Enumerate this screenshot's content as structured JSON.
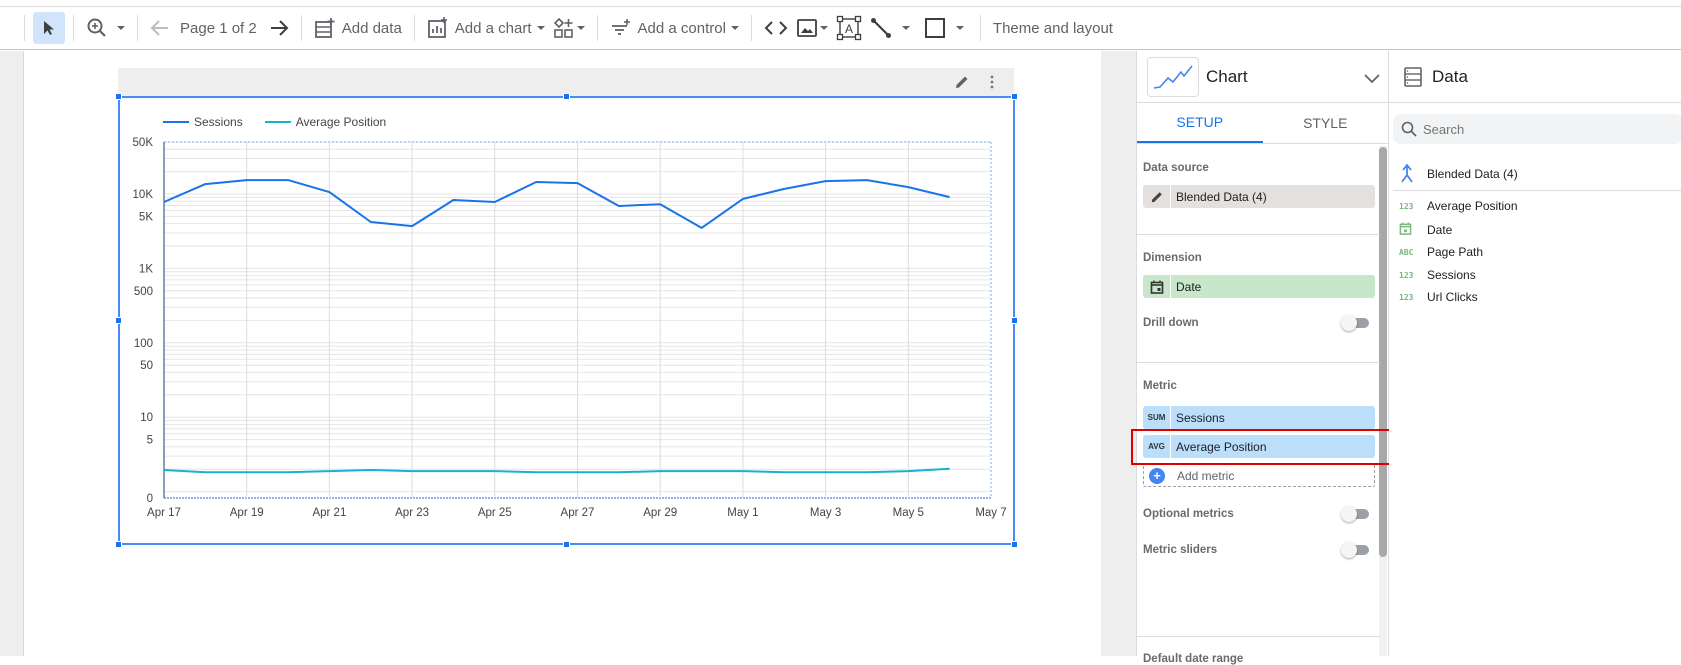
{
  "toolbar": {
    "page_indicator": "Page 1 of 2",
    "add_data": "Add data",
    "add_chart": "Add a chart",
    "add_control": "Add a control",
    "theme_layout": "Theme and layout"
  },
  "chart": {
    "legend": [
      {
        "name": "Sessions",
        "color": "#1a73e8"
      },
      {
        "name": "Average Position",
        "color": "#12b5cb"
      }
    ]
  },
  "chart_data": {
    "type": "line",
    "title": "",
    "xlabel": "",
    "ylabel": "",
    "y_scale": "log",
    "ylim": [
      0,
      50000
    ],
    "y_ticks": [
      "50K",
      "10K",
      "5K",
      "1K",
      "500",
      "100",
      "50",
      "10",
      "5",
      "0"
    ],
    "y_tick_values": [
      50000,
      10000,
      5000,
      1000,
      500,
      100,
      50,
      10,
      5,
      0
    ],
    "x_ticks": [
      "Apr 17",
      "Apr 19",
      "Apr 21",
      "Apr 23",
      "Apr 25",
      "Apr 27",
      "Apr 29",
      "May 1",
      "May 3",
      "May 5",
      "May 7"
    ],
    "x": [
      "Apr 17",
      "Apr 18",
      "Apr 19",
      "Apr 20",
      "Apr 21",
      "Apr 22",
      "Apr 23",
      "Apr 24",
      "Apr 25",
      "Apr 26",
      "Apr 27",
      "Apr 28",
      "Apr 29",
      "Apr 30",
      "May 1",
      "May 2",
      "May 3",
      "May 4",
      "May 5",
      "May 6"
    ],
    "grid": true,
    "legend_position": "top-left",
    "series": [
      {
        "name": "Sessions",
        "color": "#1a73e8",
        "values": [
          7800,
          13600,
          15400,
          15400,
          10600,
          4200,
          3700,
          8300,
          7800,
          14500,
          14000,
          6900,
          7300,
          3500,
          8600,
          11700,
          14900,
          15400,
          12400,
          9100
        ]
      },
      {
        "name": "Average Position",
        "color": "#12b5cb",
        "values": [
          2.4,
          2.2,
          2.2,
          2.2,
          2.3,
          2.4,
          2.3,
          2.3,
          2.3,
          2.2,
          2.2,
          2.2,
          2.3,
          2.3,
          2.3,
          2.2,
          2.2,
          2.2,
          2.3,
          2.5
        ]
      }
    ]
  },
  "properties": {
    "title": "Chart",
    "tabs": [
      {
        "label": "SETUP",
        "active": true
      },
      {
        "label": "STYLE",
        "active": false
      }
    ],
    "data_source_label": "Data source",
    "data_source_value": "Blended Data (4)",
    "dimension_label": "Dimension",
    "dimension_value": "Date",
    "drill_down_label": "Drill down",
    "drill_down_on": false,
    "metric_label": "Metric",
    "metrics": [
      {
        "agg": "SUM",
        "name": "Sessions"
      },
      {
        "agg": "AVG",
        "name": "Average Position"
      }
    ],
    "add_metric_label": "Add metric",
    "optional_metrics_label": "Optional metrics",
    "optional_metrics_on": false,
    "metric_sliders_label": "Metric sliders",
    "metric_sliders_on": false,
    "default_date_range_label": "Default date range"
  },
  "data_panel": {
    "title": "Data",
    "search_placeholder": "Search",
    "data_source": "Blended Data (4)",
    "fields": [
      {
        "type": "123",
        "name": "Average Position"
      },
      {
        "type": "date",
        "name": "Date"
      },
      {
        "type": "ABC",
        "name": "Page Path"
      },
      {
        "type": "123",
        "name": "Sessions"
      },
      {
        "type": "123",
        "name": "Url Clicks"
      }
    ]
  },
  "colors": {
    "accent": "#1a73e8",
    "sessions_line": "#1a73e8",
    "avg_position_line": "#12b5cb",
    "dimension_chip": "#c8e6c9",
    "metric_chip": "#bbdefb",
    "highlight_box": "#e00000"
  }
}
